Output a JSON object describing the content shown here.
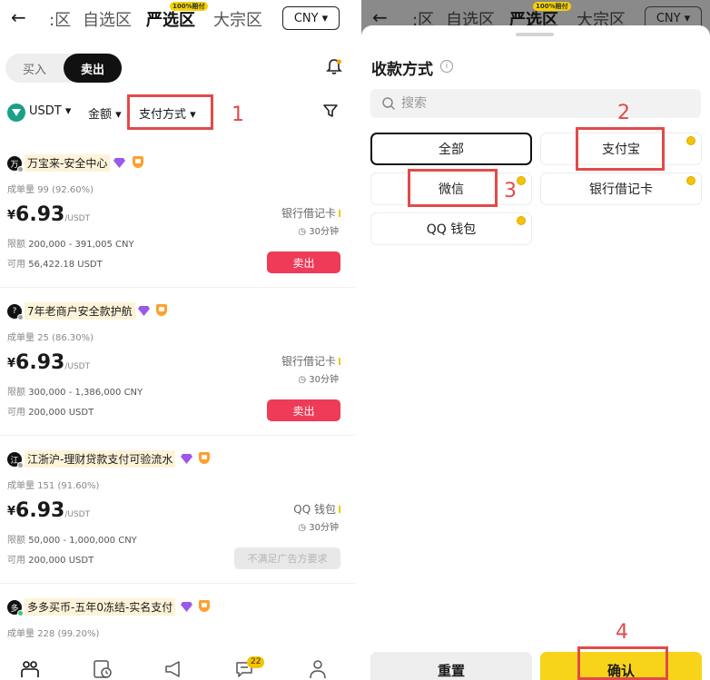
{
  "nav": {
    "back": "←",
    "tabs": [
      ":区",
      "自选区",
      "严选区",
      "大宗区"
    ],
    "badge": "100%赔付",
    "currency": "CNY"
  },
  "toggle": {
    "buy": "买入",
    "sell": "卖出"
  },
  "filters": {
    "asset": "USDT",
    "amount": "金额",
    "payment": "支付方式"
  },
  "annotations": [
    "1",
    "2",
    "3",
    "4"
  ],
  "merchants": [
    {
      "avatar": "万",
      "name": "万宝来-安全中心",
      "rate_label": "成单量",
      "rate": "99 (92.60%)",
      "currency_symbol": "¥",
      "price": "6.93",
      "unit": "/USDT",
      "limit_label": "限额",
      "limit": "200,000 - 391,005 CNY",
      "avail_label": "可用",
      "available": "56,422.18 USDT",
      "payment": "银行借记卡",
      "time": "30分钟",
      "action": "卖出",
      "disabled": false
    },
    {
      "avatar": "?",
      "name": "7年老商户安全款护航",
      "rate_label": "成单量",
      "rate": "25 (86.30%)",
      "currency_symbol": "¥",
      "price": "6.93",
      "unit": "/USDT",
      "limit_label": "限额",
      "limit": "300,000 - 1,386,000 CNY",
      "avail_label": "可用",
      "available": "200,000 USDT",
      "payment": "银行借记卡",
      "time": "30分钟",
      "action": "卖出",
      "disabled": false
    },
    {
      "avatar": "江",
      "name": "江浙沪-理财贷款支付可验流水",
      "rate_label": "成单量",
      "rate": "151 (91.60%)",
      "currency_symbol": "¥",
      "price": "6.93",
      "unit": "/USDT",
      "limit_label": "限额",
      "limit": "50,000 - 1,000,000 CNY",
      "avail_label": "可用",
      "available": "200,000 USDT",
      "payment": "QQ 钱包",
      "time": "30分钟",
      "action": "不满足广告方要求",
      "disabled": true
    },
    {
      "avatar": "多",
      "name": "多多买币-五年0冻结-实名支付",
      "rate_label": "成单量",
      "rate": "228 (99.20%)"
    }
  ],
  "tabbar": {
    "chat_badge": "22"
  },
  "sheet": {
    "title": "收款方式",
    "search_placeholder": "搜索",
    "options": [
      "全部",
      "支付宝",
      "微信",
      "银行借记卡",
      "QQ 钱包"
    ],
    "reset": "重置",
    "confirm": "确认"
  },
  "colors": {
    "accent_red": "#ee3b57",
    "accent_yellow": "#f7d31a",
    "annotation": "#e24a4a"
  }
}
